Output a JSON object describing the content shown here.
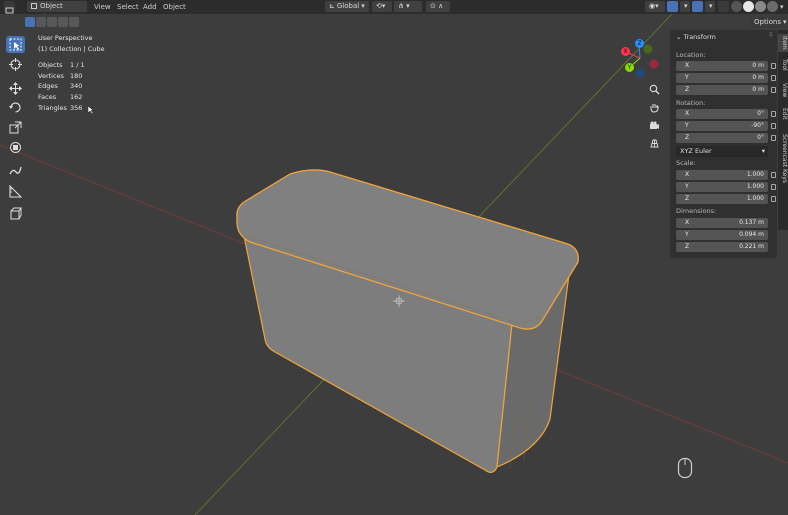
{
  "header": {
    "mode": "Object Mode",
    "menus": [
      "View",
      "Select",
      "Add",
      "Object"
    ],
    "orientation": "Global",
    "options_label": "Options"
  },
  "viewport": {
    "view_name": "User Perspective",
    "collection": "(1) Collection | Cube"
  },
  "stats": [
    {
      "label": "Objects",
      "value": "1 / 1"
    },
    {
      "label": "Vertices",
      "value": "180"
    },
    {
      "label": "Edges",
      "value": "340"
    },
    {
      "label": "Faces",
      "value": "162"
    },
    {
      "label": "Triangles",
      "value": "356"
    }
  ],
  "gizmo": {
    "x": "X",
    "y": "Y",
    "z": "Z"
  },
  "transform": {
    "title": "Transform",
    "location_label": "Location:",
    "location": [
      {
        "axis": "X",
        "value": "0 m"
      },
      {
        "axis": "Y",
        "value": "0 m"
      },
      {
        "axis": "Z",
        "value": "0 m"
      }
    ],
    "rotation_label": "Rotation:",
    "rotation": [
      {
        "axis": "X",
        "value": "0°"
      },
      {
        "axis": "Y",
        "value": "-90°"
      },
      {
        "axis": "Z",
        "value": "0°"
      }
    ],
    "rotation_mode": "XYZ Euler",
    "scale_label": "Scale:",
    "scale": [
      {
        "axis": "X",
        "value": "1.000"
      },
      {
        "axis": "Y",
        "value": "1.000"
      },
      {
        "axis": "Z",
        "value": "1.000"
      }
    ],
    "dimensions_label": "Dimensions:",
    "dimensions": [
      {
        "axis": "X",
        "value": "0.137 m"
      },
      {
        "axis": "Y",
        "value": "0.094 m"
      },
      {
        "axis": "Z",
        "value": "0.221 m"
      }
    ]
  },
  "side_tabs": [
    "Item",
    "Tool",
    "View",
    "Edit",
    "Screencast Keys"
  ],
  "colors": {
    "accent": "#4772b3",
    "selection": "#f0a43a",
    "axis_x": "#ff3352",
    "axis_y": "#8bdc00",
    "axis_z": "#2890ff"
  }
}
